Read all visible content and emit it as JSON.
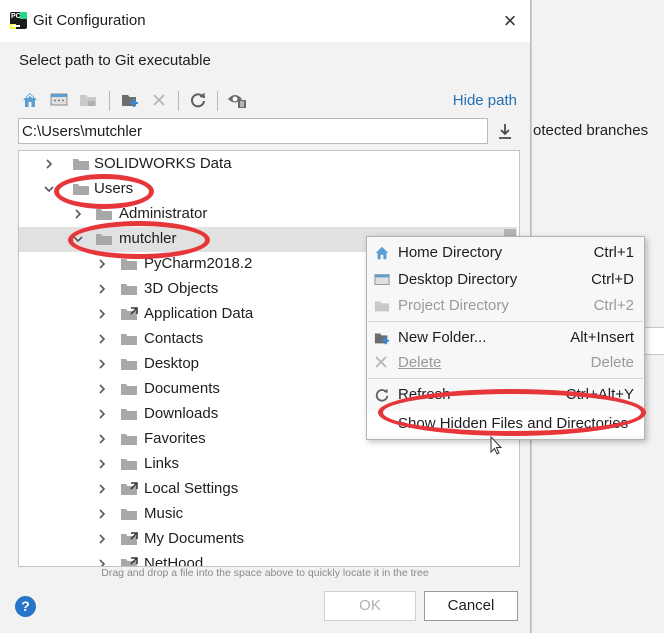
{
  "background": {
    "text": "otected branches"
  },
  "dialog": {
    "title": "Git Configuration",
    "close_glyph": "×",
    "subtitle": "Select path to Git executable",
    "toolbar": {
      "icons": [
        "home-icon",
        "desktop-icon",
        "project-icon",
        "new-folder-icon",
        "delete-icon",
        "refresh-icon",
        "show-hidden-icon"
      ],
      "hide_path": "Hide path"
    },
    "path_value": "C:\\Users\\mutchler",
    "tree": {
      "items": [
        {
          "label": "SOLIDWORKS Data",
          "type": "folder",
          "expanded": false
        },
        {
          "label": "Users",
          "type": "folder",
          "expanded": true
        },
        {
          "label": "Administrator",
          "type": "folder",
          "expanded": false
        },
        {
          "label": "mutchler",
          "type": "folder",
          "expanded": true,
          "selected": true
        },
        {
          "label": "PyCharm2018.2",
          "type": "folder",
          "expanded": false
        },
        {
          "label": "3D Objects",
          "type": "folder",
          "expanded": false
        },
        {
          "label": "Application Data",
          "type": "shortcut",
          "expanded": false
        },
        {
          "label": "Contacts",
          "type": "folder",
          "expanded": false
        },
        {
          "label": "Desktop",
          "type": "folder",
          "expanded": false
        },
        {
          "label": "Documents",
          "type": "folder",
          "expanded": false
        },
        {
          "label": "Downloads",
          "type": "folder",
          "expanded": false
        },
        {
          "label": "Favorites",
          "type": "folder",
          "expanded": false
        },
        {
          "label": "Links",
          "type": "folder",
          "expanded": false
        },
        {
          "label": "Local Settings",
          "type": "shortcut",
          "expanded": false
        },
        {
          "label": "Music",
          "type": "folder",
          "expanded": false
        },
        {
          "label": "My Documents",
          "type": "shortcut",
          "expanded": false
        },
        {
          "label": "NetHood",
          "type": "shortcut",
          "expanded": false
        }
      ]
    },
    "hint": "Drag and drop a file into the space above to quickly locate it in the tree",
    "buttons": {
      "help": "?",
      "ok": "OK",
      "cancel": "Cancel"
    }
  },
  "context_menu": {
    "items": [
      {
        "label": "Home Directory",
        "shortcut": "Ctrl+1",
        "icon": "home-icon",
        "enabled": true
      },
      {
        "label": "Desktop Directory",
        "shortcut": "Ctrl+D",
        "icon": "desktop-icon",
        "enabled": true
      },
      {
        "label": "Project Directory",
        "shortcut": "Ctrl+2",
        "icon": "project-icon",
        "enabled": false
      },
      {
        "label": "New Folder...",
        "shortcut": "Alt+Insert",
        "icon": "new-folder-icon",
        "enabled": true
      },
      {
        "label": "Delete",
        "shortcut": "Delete",
        "icon": "delete-icon",
        "enabled": false
      },
      {
        "label": "Refresh",
        "shortcut": "Ctrl+Alt+Y",
        "icon": "refresh-icon",
        "enabled": true
      },
      {
        "label": "Show Hidden Files and Directories",
        "shortcut": "",
        "icon": "",
        "enabled": true,
        "highlighted": true
      }
    ]
  },
  "colors": {
    "annotation": "#e6363a",
    "link": "#2470b3",
    "help": "#2774c8",
    "folder": "#a8a8a8"
  }
}
